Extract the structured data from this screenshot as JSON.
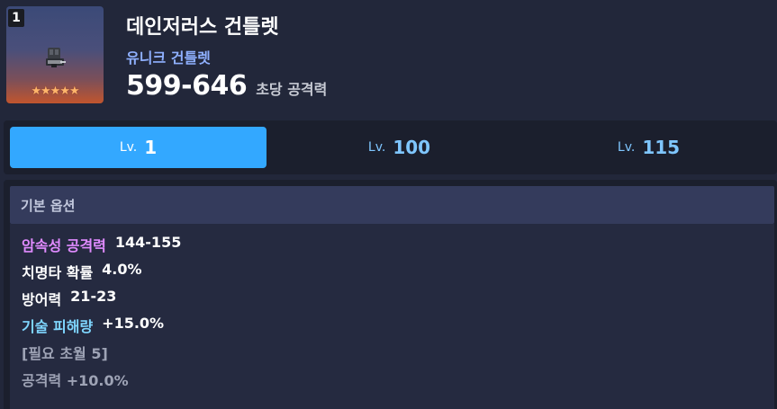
{
  "item": {
    "level_badge": "1",
    "stars": "★★★★★",
    "name": "데인저러스 건틀렛",
    "type": "유니크 건틀렛",
    "attack_range": "599-646",
    "attack_unit": "초당 공격력",
    "icon": "gauntlet-icon",
    "star_color": "#ffb56b"
  },
  "tabs": [
    {
      "prefix": "Lv.",
      "level": "1",
      "active": true
    },
    {
      "prefix": "Lv.",
      "level": "100",
      "active": false
    },
    {
      "prefix": "Lv.",
      "level": "115",
      "active": false
    }
  ],
  "options": {
    "header": "기본 옵션",
    "rows": [
      {
        "label": "암속성 공격력",
        "value": "144-155",
        "color": "#e08bff"
      },
      {
        "label": "치명타 확률",
        "value": "4.0%",
        "color": "#ffffff"
      },
      {
        "label": "방어력",
        "value": "21-23",
        "color": "#ffffff"
      },
      {
        "label": "기술 피해량",
        "value": "+15.0%",
        "color": "#7fd6ff"
      },
      {
        "label": "[필요 초월 5]",
        "value": "",
        "color": "#9ea3b5"
      },
      {
        "label": "공격력 +10.0%",
        "value": "",
        "color": "#9ea3b5"
      }
    ]
  },
  "colors": {
    "accent": "#33a8ff",
    "background": "#22273a",
    "panel": "#1b1f2d"
  }
}
